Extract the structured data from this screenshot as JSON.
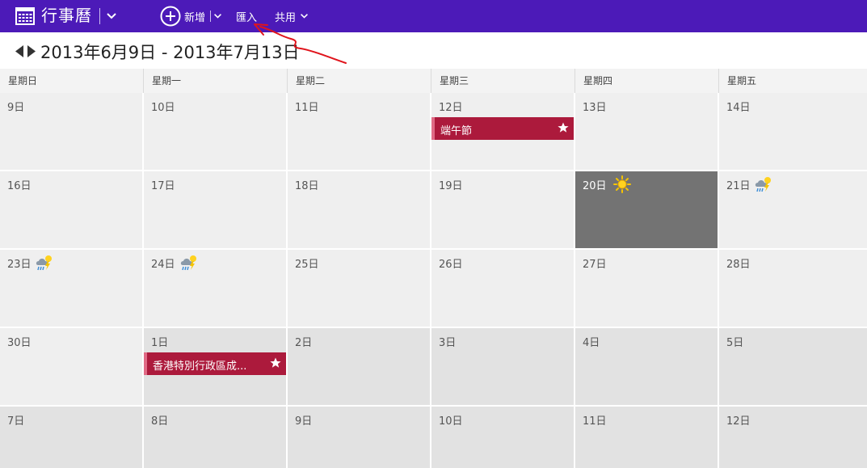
{
  "app": {
    "title": "行事曆",
    "new_label": "新增",
    "import_label": "匯入",
    "share_label": "共用"
  },
  "range": {
    "text": "2013年6月9日 - 2013年7月13日"
  },
  "weekdays": [
    "星期日",
    "星期一",
    "星期二",
    "星期三",
    "星期四",
    "星期五"
  ],
  "weeks": [
    [
      "9日",
      "10日",
      "11日",
      "12日",
      "13日",
      "14日"
    ],
    [
      "16日",
      "17日",
      "18日",
      "19日",
      "20日",
      "21日"
    ],
    [
      "23日",
      "24日",
      "25日",
      "26日",
      "27日",
      "28日"
    ],
    [
      "30日",
      "1日",
      "2日",
      "3日",
      "4日",
      "5日"
    ],
    [
      "7日",
      "8日",
      "9日",
      "10日",
      "11日",
      "12日"
    ]
  ],
  "events": [
    {
      "title": "端午節"
    },
    {
      "title": "香港特別行政區成..."
    }
  ],
  "colors": {
    "topbar": "#4c1ab8",
    "event": "#ac1a3c",
    "today": "#737373",
    "annotation": "#e0141c"
  },
  "icons": {
    "app": "calendar-grid-icon",
    "new": "plus-circle-icon",
    "event": "star-icon",
    "weather_sunny": "sun-icon",
    "weather_storm": "thunder-rain-icon"
  }
}
